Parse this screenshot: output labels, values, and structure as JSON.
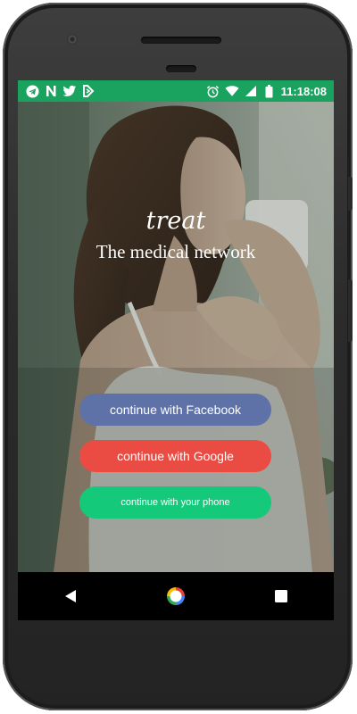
{
  "colors": {
    "status_bar": "#1aa25f",
    "facebook": "#5e72a8",
    "google": "#ea4c44",
    "phone": "#14c97a"
  },
  "status_bar": {
    "left_icons": [
      "telegram-icon",
      "n-notification-icon",
      "twitter-icon",
      "feedly-icon"
    ],
    "right_icons": [
      "alarm-icon",
      "wifi-icon",
      "signal-icon",
      "battery-icon"
    ],
    "time": "11:18:08"
  },
  "hero": {
    "brand": "treat",
    "tagline": "The medical network"
  },
  "auth": {
    "facebook_label": "continue with Facebook",
    "google_label": "continue with Google",
    "phone_label": "continue with your phone"
  },
  "nav": {
    "icons": [
      "back-icon",
      "home-icon",
      "recents-icon"
    ]
  }
}
